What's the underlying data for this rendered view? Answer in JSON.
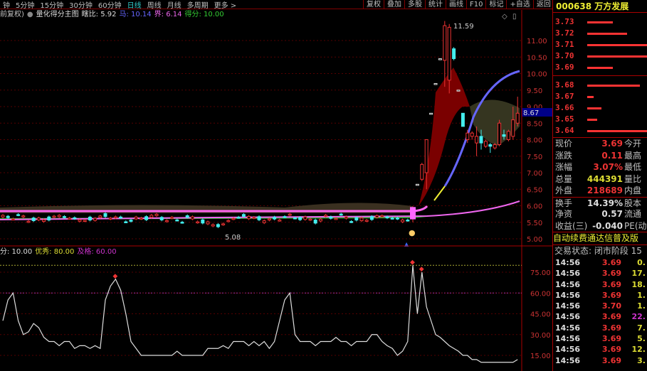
{
  "toolbar": {
    "periods": [
      "钟",
      "5分钟",
      "15分钟",
      "30分钟",
      "60分钟",
      "日线",
      "周线",
      "月线",
      "多周期",
      "更多 >"
    ],
    "active": "日线",
    "buttons": [
      "复权",
      "叠加",
      "多股",
      "统计",
      "画线",
      "F10",
      "标记",
      "+自选",
      "返回"
    ]
  },
  "info": {
    "prefix": "前复权)",
    "indicator": "量化得分主图",
    "ratio_label": "瞎比: 5.92",
    "ma_label": "马: 10.14",
    "jie_label": "界: 6.14",
    "score_label": "得分: 10.00"
  },
  "lower_info": {
    "score": "分: 10.00",
    "excellent": "优秀: 80.00",
    "pass": "及格: 60.00"
  },
  "colors": {
    "up": "#e33",
    "down": "#4ee",
    "score_line": "#ddd",
    "ma_blue": "#66f",
    "ma_pink": "#f6f"
  },
  "price_axis": {
    "ticks": [
      "11.00",
      "10.50",
      "10.00",
      "9.50",
      "9.00",
      "8.50",
      "8.00",
      "7.50",
      "7.00",
      "6.50",
      "6.00",
      "5.50",
      "5.00"
    ],
    "current": "8.67",
    "high_label": "11.59",
    "low_label": "5.08"
  },
  "score_axis": {
    "ticks": [
      "75.00",
      "60.00",
      "45.00",
      "30.00",
      "15.00"
    ]
  },
  "chart_data": {
    "type": "candlestick",
    "post_candles": [
      [
        5.6,
        5.98,
        5.5,
        5.95
      ],
      [
        6.65,
        6.65,
        6.65,
        6.65
      ],
      [
        6.8,
        7.3,
        6.75,
        7.25
      ],
      [
        7.0,
        8.0,
        6.5,
        8.0
      ],
      [
        8.8,
        8.8,
        8.8,
        8.8
      ],
      [
        9.7,
        9.7,
        9.7,
        9.7
      ],
      [
        10.45,
        10.45,
        10.45,
        10.45
      ],
      [
        10.4,
        11.59,
        9.6,
        11.45
      ],
      [
        9.8,
        11.5,
        9.4,
        11.4
      ],
      [
        10.75,
        10.8,
        10.4,
        10.45
      ],
      [
        9.5,
        9.5,
        9.5,
        9.5
      ],
      [
        8.8,
        8.8,
        8.4,
        8.4
      ],
      [
        8.0,
        8.3,
        7.9,
        8.2
      ],
      [
        8.1,
        8.25,
        8.0,
        8.2
      ],
      [
        7.9,
        8.4,
        7.5,
        8.1
      ],
      [
        8.1,
        8.3,
        7.7,
        7.9
      ],
      [
        7.8,
        8.0,
        7.75,
        7.95
      ],
      [
        7.85,
        7.9,
        7.6,
        7.8
      ],
      [
        7.75,
        7.9,
        7.7,
        7.85
      ],
      [
        7.85,
        8.6,
        7.8,
        8.5
      ],
      [
        8.15,
        8.3,
        8.0,
        8.1
      ],
      [
        8.0,
        8.3,
        7.95,
        8.25
      ],
      [
        8.1,
        9.0,
        8.0,
        8.6
      ],
      [
        8.5,
        9.3,
        8.4,
        8.8
      ]
    ],
    "score": [
      40,
      55,
      60,
      40,
      30,
      32,
      38,
      35,
      28,
      25,
      25,
      22,
      25,
      25,
      20,
      22,
      22,
      20,
      22,
      20,
      55,
      65,
      70,
      62,
      45,
      25,
      20,
      15,
      15,
      15,
      15,
      15,
      15,
      15,
      18,
      15,
      15,
      15,
      15,
      15,
      20,
      20,
      20,
      22,
      20,
      25,
      25,
      25,
      22,
      25,
      22,
      25,
      20,
      25,
      40,
      55,
      60,
      30,
      25,
      25,
      25,
      22,
      25,
      25,
      25,
      28,
      25,
      25,
      22,
      25,
      25,
      25,
      30,
      30,
      25,
      22,
      20,
      15,
      18,
      25,
      80,
      45,
      75,
      50,
      40,
      30,
      28,
      25,
      22,
      20,
      18,
      15,
      15,
      12,
      12,
      10,
      10,
      10,
      10,
      10,
      10,
      10,
      10,
      12
    ],
    "score_ref": {
      "excellent": 80,
      "pass": 60
    }
  },
  "stock": {
    "title": "000638 万方发展"
  },
  "orderbook": [
    {
      "p": "3.73",
      "w": 0.42
    },
    {
      "p": "3.72",
      "w": 0.66
    },
    {
      "p": "3.71",
      "w": 1
    },
    {
      "p": "3.70",
      "w": 1
    },
    {
      "p": "3.69",
      "w": 0.42
    },
    {
      "p": "3.68",
      "w": 0.87
    },
    {
      "p": "3.67",
      "w": 0.11
    },
    {
      "p": "3.66",
      "w": 0.23
    },
    {
      "p": "3.65",
      "w": 0.17
    },
    {
      "p": "3.64",
      "w": 1
    }
  ],
  "stats": [
    {
      "k": "现价",
      "v": "3.69",
      "c": "#e33",
      "k2": "今开"
    },
    {
      "k": "涨跌",
      "v": "0.11",
      "c": "#e33",
      "k2": "最高"
    },
    {
      "k": "涨幅",
      "v": "3.07%",
      "c": "#e33",
      "k2": "最低"
    },
    {
      "k": "总量",
      "v": "444391",
      "c": "#dd3",
      "k2": "量比"
    },
    {
      "k": "外盘",
      "v": "218689",
      "c": "#e33",
      "k2": "内盘"
    },
    {
      "k": "换手",
      "v": "14.39%",
      "c": "#ddd",
      "k2": "股本"
    },
    {
      "k": "净资",
      "v": "0.57",
      "c": "#ddd",
      "k2": "流通"
    },
    {
      "k": "收益(三)",
      "v": "-0.040",
      "c": "#ddd",
      "k2": "PE(动"
    }
  ],
  "ad": "自动续费通达信普及版",
  "trade_status": "交易状态: 闭市阶段 15",
  "ticks": [
    {
      "t": "14:56",
      "p": "3.69",
      "v": "0."
    },
    {
      "t": "14:56",
      "p": "3.69",
      "v": "17."
    },
    {
      "t": "14:56",
      "p": "3.69",
      "v": "18."
    },
    {
      "t": "14:56",
      "p": "3.69",
      "v": "1."
    },
    {
      "t": "14:56",
      "p": "3.70",
      "v": "1."
    },
    {
      "t": "14:56",
      "p": "3.69",
      "v": "22.",
      "c": "#c3c"
    },
    {
      "t": "14:56",
      "p": "3.69",
      "v": "7."
    },
    {
      "t": "14:56",
      "p": "3.69",
      "v": "5."
    },
    {
      "t": "14:56",
      "p": "3.69",
      "v": "12."
    },
    {
      "t": "14:56",
      "p": "3.69",
      "v": "3."
    }
  ]
}
